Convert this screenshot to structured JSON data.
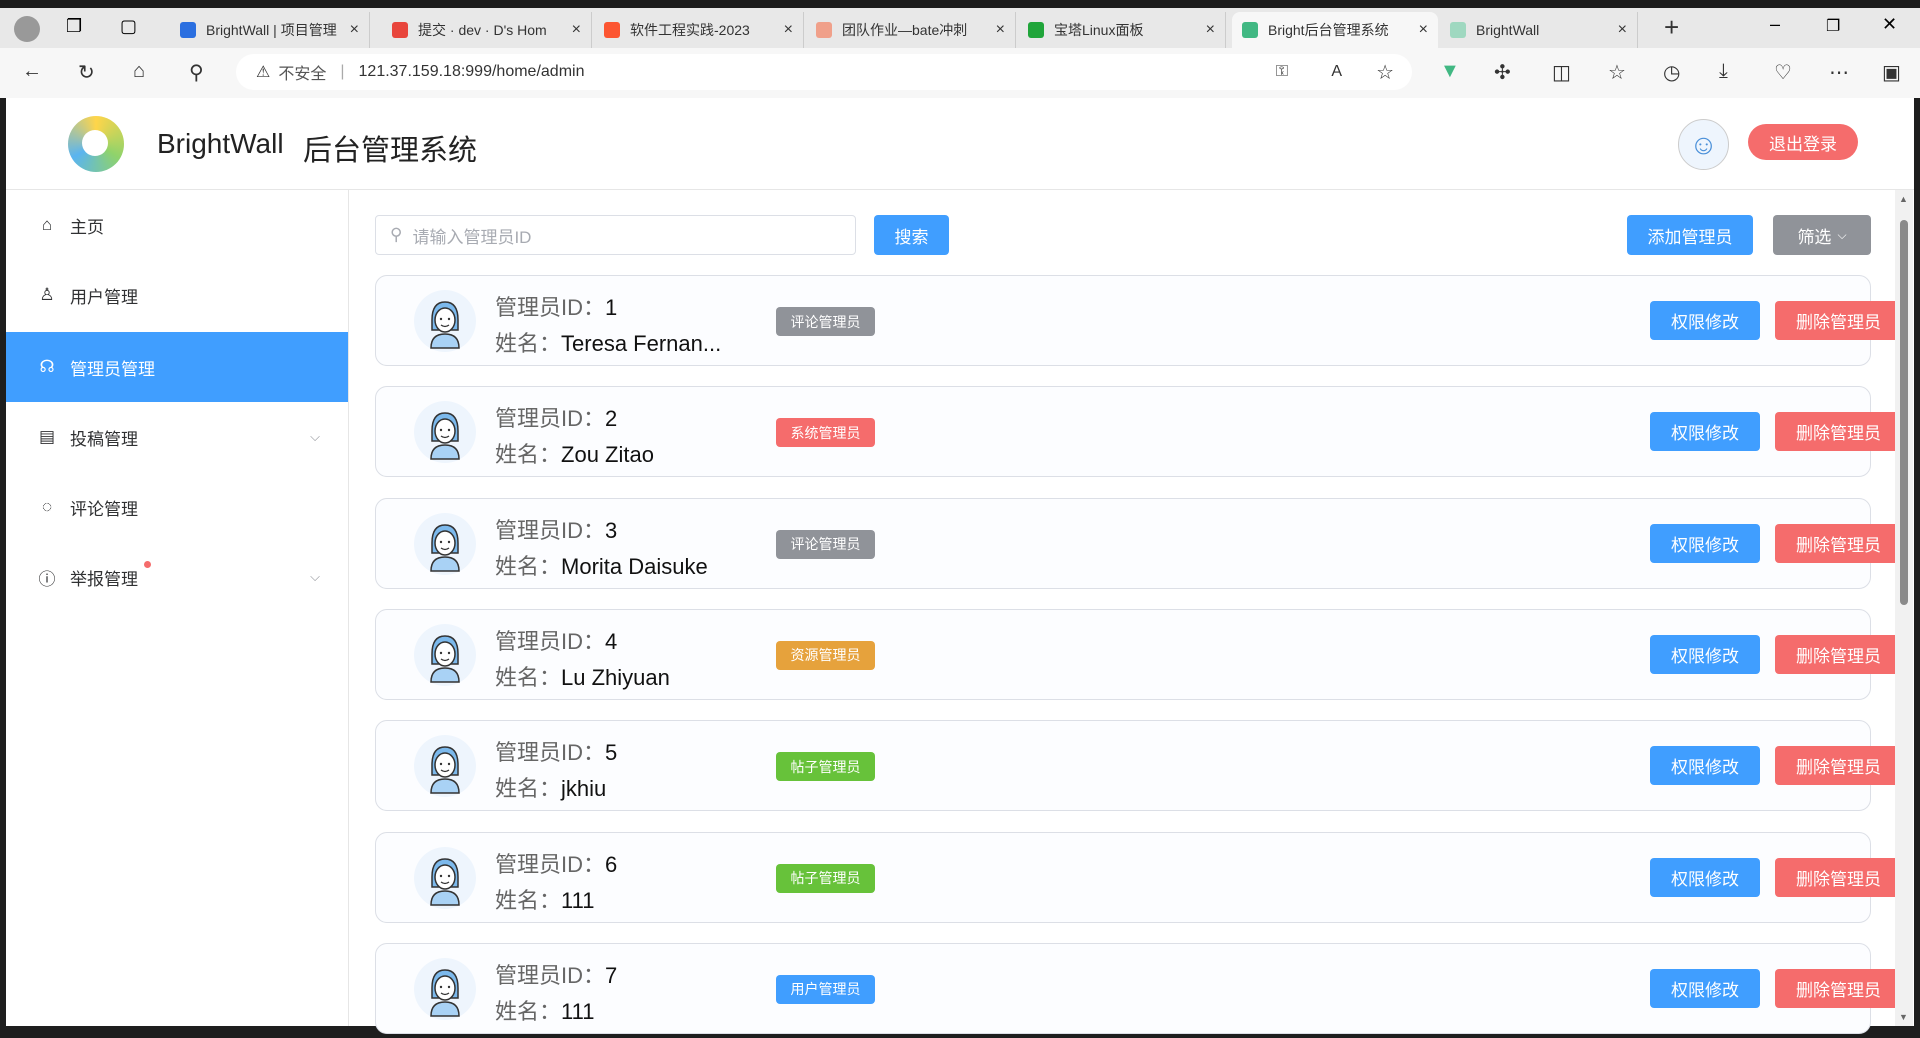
{
  "browser": {
    "tabs": [
      {
        "title": "BrightWall | 项目管理",
        "color": "#2b6fe0"
      },
      {
        "title": "提交 · dev · D's Hom",
        "color": "#e8453c"
      },
      {
        "title": "软件工程实践-2023",
        "color": "#fc5531"
      },
      {
        "title": "团队作业—bate冲刺",
        "color": "#f0a08a"
      },
      {
        "title": "宝塔Linux面板",
        "color": "#20a53a"
      },
      {
        "title": "Bright后台管理系统",
        "color": "#41b883"
      },
      {
        "title": "BrightWall",
        "color": "#9fd8c0"
      }
    ],
    "active_tab": 5,
    "close": "×",
    "new_tab": "+",
    "insecure": "不安全",
    "url": "121.37.159.18:999/home/admin"
  },
  "header": {
    "brand": "BrightWall",
    "title": "后台管理系统",
    "logout": "退出登录"
  },
  "sidebar": {
    "items": [
      {
        "label": "主页",
        "icon": "⌂"
      },
      {
        "label": "用户管理",
        "icon": "♙"
      },
      {
        "label": "管理员管理",
        "icon": "☊"
      },
      {
        "label": "投稿管理",
        "icon": "▤"
      },
      {
        "label": "评论管理",
        "icon": "◌"
      },
      {
        "label": "举报管理",
        "icon": "ⓘ"
      }
    ]
  },
  "toolbar": {
    "search_placeholder": "请输入管理员ID",
    "search": "搜索",
    "add": "添加管理员",
    "filter": "筛选"
  },
  "labels": {
    "id": "管理员ID：",
    "name": "姓名：",
    "edit": "权限修改",
    "delete": "删除管理员"
  },
  "admins": [
    {
      "id": "1",
      "name": "Teresa Fernan...",
      "role": "评论管理员",
      "color": "#909399"
    },
    {
      "id": "2",
      "name": "Zou Zitao",
      "role": "系统管理员",
      "color": "#f56c6c"
    },
    {
      "id": "3",
      "name": "Morita Daisuke",
      "role": "评论管理员",
      "color": "#909399"
    },
    {
      "id": "4",
      "name": "Lu Zhiyuan",
      "role": "资源管理员",
      "color": "#e6a23c"
    },
    {
      "id": "5",
      "name": "jkhiu",
      "role": "帖子管理员",
      "color": "#67c23a"
    },
    {
      "id": "6",
      "name": "111",
      "role": "帖子管理员",
      "color": "#67c23a"
    },
    {
      "id": "7",
      "name": "111",
      "role": "用户管理员",
      "color": "#409eff"
    }
  ]
}
